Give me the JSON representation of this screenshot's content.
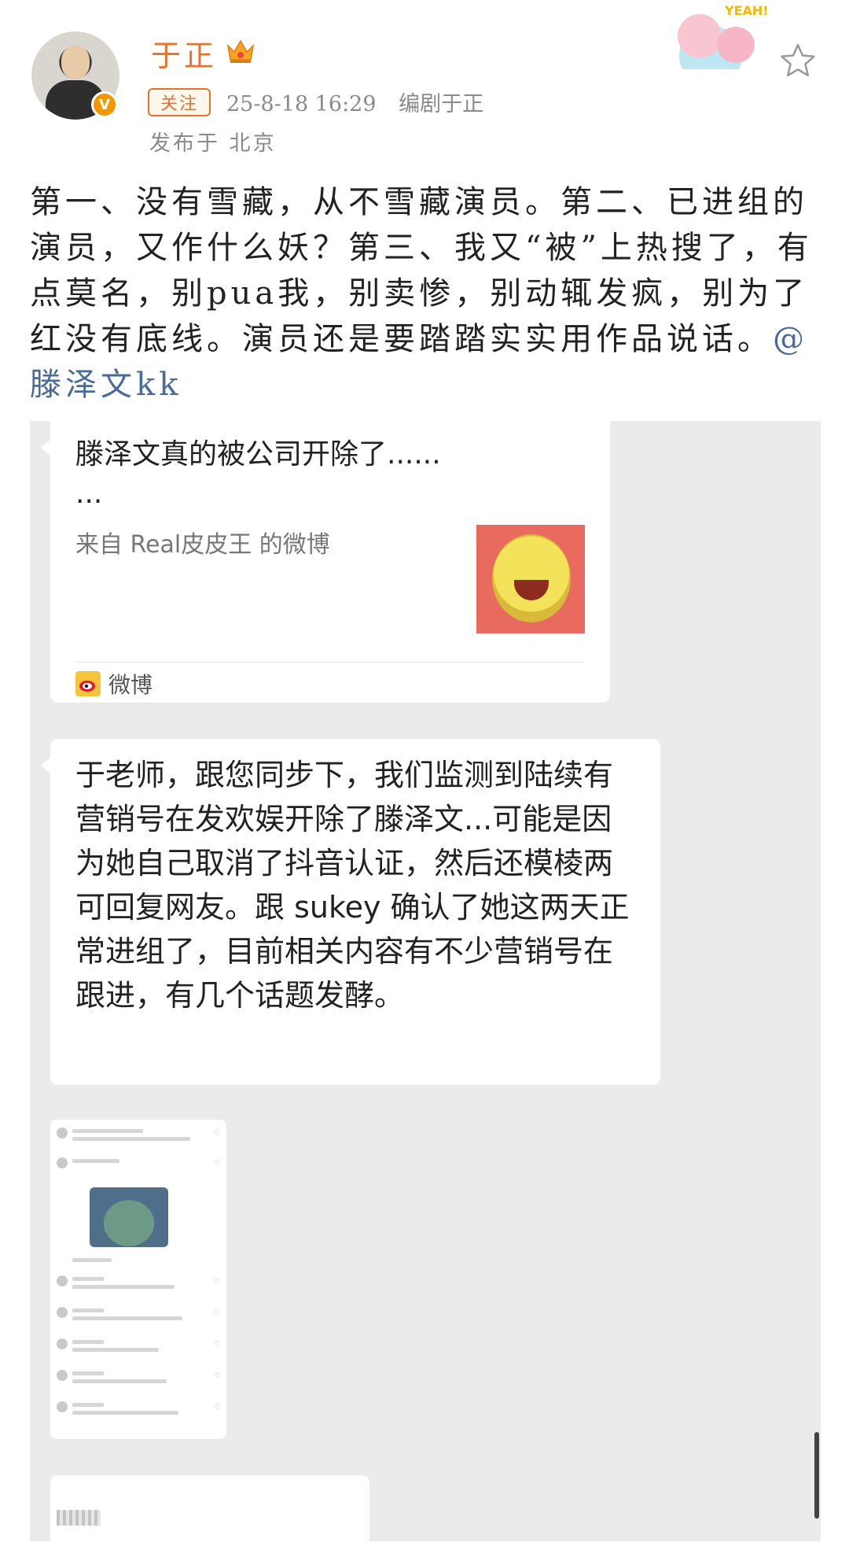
{
  "header": {
    "username": "于正",
    "follow_label": "关注",
    "timestamp": "25-8-18 16:29",
    "source": "编剧于正",
    "location": "发布于 北京",
    "verified_badge": "V"
  },
  "post": {
    "text": "第一、没有雪藏，从不雪藏演员。第二、已进组的演员，又作什么妖？第三、我又“被”上热搜了，有点莫名，别pua我，别卖惨，别动辄发疯，别为了红没有底线。演员还是要踏踏实实用作品说话。",
    "mention": "@滕泽文kk"
  },
  "screenshot": {
    "card": {
      "title": "滕泽文真的被公司开除了......\n...",
      "source": "来自 Real皮皮王 的微博",
      "brand": "微博"
    },
    "message": "于老师，跟您同步下，我们监测到陆续有营销号在发欢娱开除了滕泽文...可能是因为她自己取消了抖音认证，然后还模棱两可回复网友。跟 sukey 确认了她这两天正常进组了，目前相关内容有不少营销号在跟进，有几个话题发酵。"
  },
  "colors": {
    "accent": "#e8722a",
    "mention": "#4a6a9a",
    "chat_bg": "#ebebeb"
  },
  "icons": [
    "crown-icon",
    "verified-icon",
    "star-icon",
    "weibo-icon"
  ]
}
